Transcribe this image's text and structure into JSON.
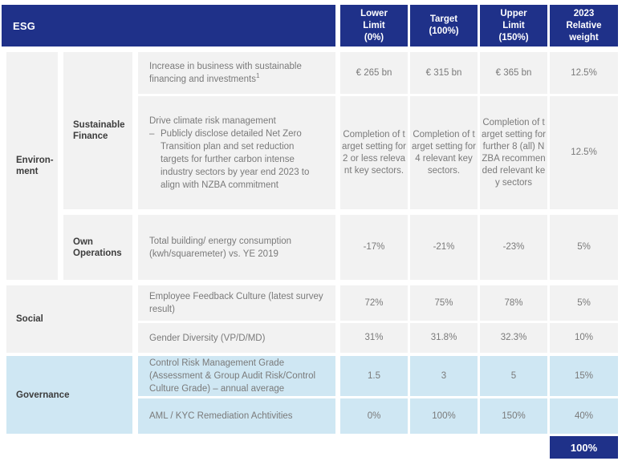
{
  "header": {
    "title": "ESG",
    "columns": [
      {
        "id": "lower-limit",
        "line1": "Lower",
        "line2": "Limit",
        "line3": "(0%)"
      },
      {
        "id": "target",
        "line1": "Target",
        "line2": "(100%)",
        "line3": ""
      },
      {
        "id": "upper-limit",
        "line1": "Upper",
        "line2": "Limit",
        "line3": "(150%)"
      },
      {
        "id": "relative-weight",
        "line1": "2023",
        "line2": "Relative",
        "line3": "weight"
      }
    ]
  },
  "categories": {
    "environment": "Environ-\nment",
    "environment_line1": "Environ-",
    "environment_line2": "ment",
    "social": "Social",
    "governance": "Governance"
  },
  "subcategories": {
    "sustainable_finance_line1": "Sustainable",
    "sustainable_finance_line2": "Finance",
    "own_operations_line1": "Own",
    "own_operations_line2": "Operations"
  },
  "rows": [
    {
      "id": "sustainable-finance-business",
      "description": "Increase in business with sustainable financing and investments",
      "description_footnote": "1",
      "lower_limit": "€ 265 bn",
      "target": "€ 315 bn",
      "upper_limit": "€ 365 bn",
      "relative_weight": "12.5%"
    },
    {
      "id": "climate-risk-management",
      "description_heading": "Drive climate risk management",
      "description_bullet_dash": "–",
      "description_bullet": "Publicly disclose detailed Net Zero Transition plan and set reduction targets for further carbon intense industry sectors by year end 2023 to align with NZBA commitment",
      "lower_limit": "Completion of target setting for 2 or less relevant key sectors.",
      "target": "Completion of target setting for 4 relevant key sectors.",
      "upper_limit": "Completion of target setting for further 8 (all) NZBA recommended relevant key sectors",
      "relative_weight": "12.5%"
    },
    {
      "id": "energy-consumption",
      "description": "Total building/ energy consumption (kwh/squaremeter) vs. YE 2019",
      "lower_limit": "-17%",
      "target": "-21%",
      "upper_limit": "-23%",
      "relative_weight": "5%"
    },
    {
      "id": "employee-feedback-culture",
      "description": "Employee Feedback Culture (latest survey result)",
      "lower_limit": "72%",
      "target": "75%",
      "upper_limit": "78%",
      "relative_weight": "5%"
    },
    {
      "id": "gender-diversity",
      "description": "Gender Diversity (VP/D/MD)",
      "lower_limit": "31%",
      "target": "31.8%",
      "upper_limit": "32.3%",
      "relative_weight": "10%"
    },
    {
      "id": "control-risk-management-grade",
      "description": "Control Risk Management Grade (Assessment & Group Audit Risk/Control Culture Grade) – annual average",
      "lower_limit": "1.5",
      "target": "3",
      "upper_limit": "5",
      "relative_weight": "15%"
    },
    {
      "id": "aml-kyc-remediation",
      "description": "AML / KYC Remediation Achtivities",
      "lower_limit": "0%",
      "target": "100%",
      "upper_limit": "150%",
      "relative_weight": "40%"
    }
  ],
  "total": {
    "label": "100%"
  },
  "colors": {
    "brand_blue": "#1f3189",
    "light_blue": "#cfe7f3",
    "grey": "#f2f2f2",
    "text_grey": "#7a7a7a",
    "text_dark": "#3c3c3c"
  }
}
